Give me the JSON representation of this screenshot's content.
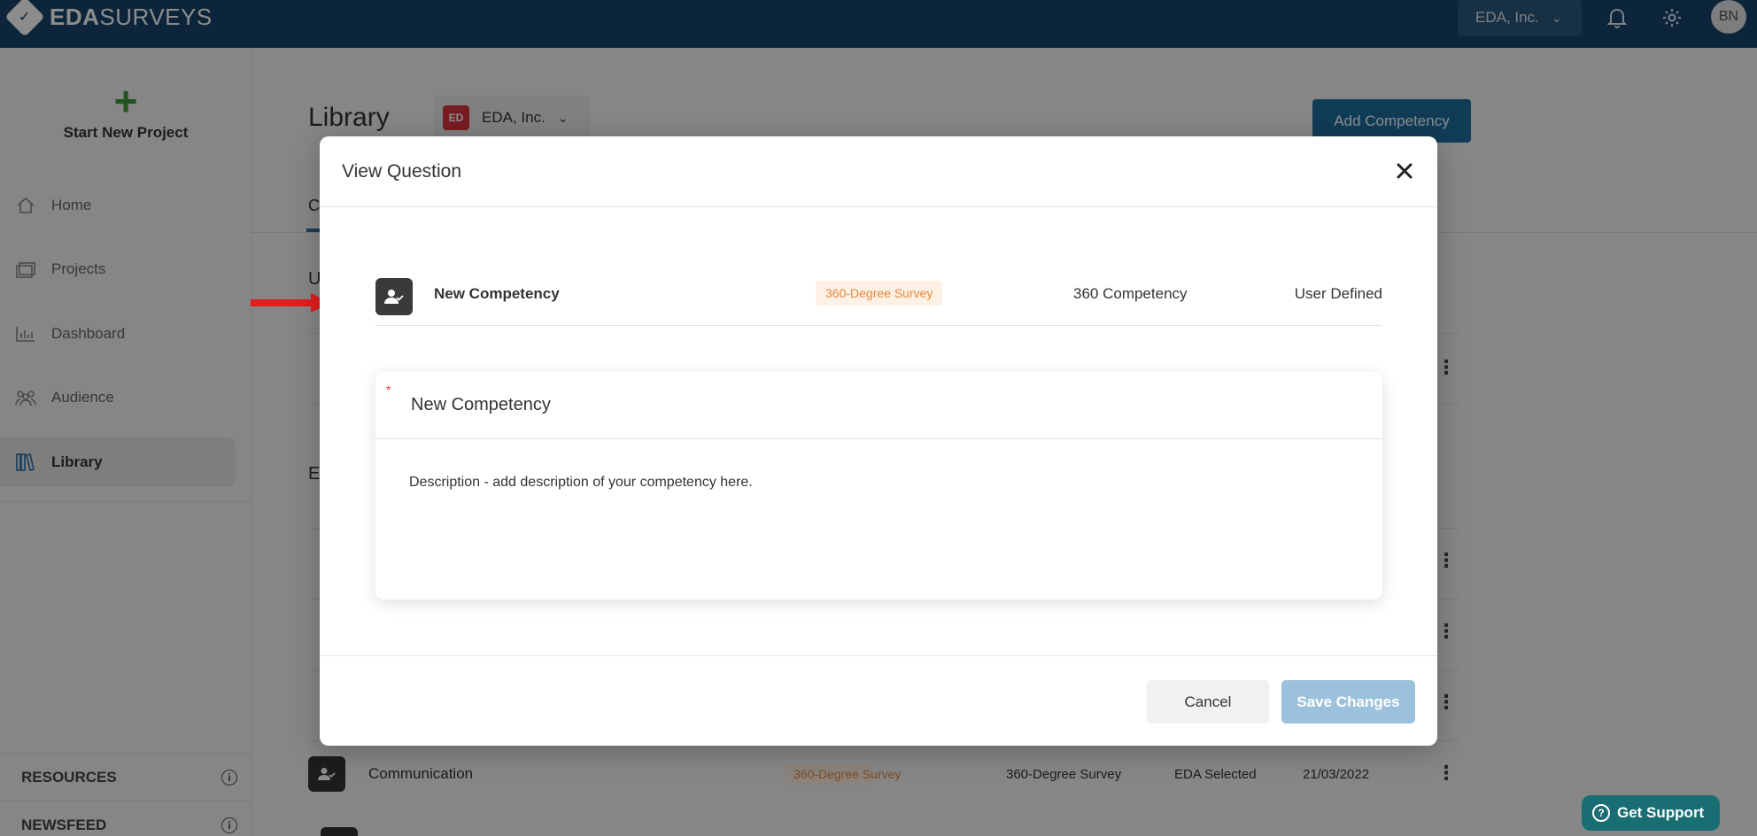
{
  "topbar": {
    "logo_bold": "EDA",
    "logo_light": "SURVEYS",
    "org_label": "EDA, Inc.",
    "avatar_initials": "BN"
  },
  "sidebar": {
    "new_project_label": "Start New Project",
    "items": [
      {
        "label": "Home",
        "icon": "home-icon"
      },
      {
        "label": "Projects",
        "icon": "folders-icon"
      },
      {
        "label": "Dashboard",
        "icon": "bar-chart-icon"
      },
      {
        "label": "Audience",
        "icon": "users-icon"
      },
      {
        "label": "Library",
        "icon": "books-icon",
        "active": true
      }
    ],
    "resources_label": "RESOURCES",
    "newsfeed_label": "NEWSFEED"
  },
  "page": {
    "title": "Library",
    "org_chip_code": "ED",
    "org_chip_label": "EDA, Inc.",
    "add_competency_label": "Add Competency",
    "tab_stub": "C",
    "section_stub_1": "U",
    "section_stub_2": "E",
    "background_row": {
      "name": "Communication",
      "badge": "360-Degree Survey",
      "type": "360-Degree Survey",
      "source": "EDA Selected",
      "date": "21/03/2022"
    }
  },
  "modal": {
    "title": "View Question",
    "question": {
      "name": "New Competency",
      "badge": "360-Degree Survey",
      "type": "360 Competency",
      "source": "User Defined"
    },
    "card": {
      "required_marker": "*",
      "title": "New Competency",
      "description": "Description - add description of your competency here."
    },
    "cancel_label": "Cancel",
    "save_label": "Save Changes"
  },
  "support": {
    "label": "Get Support"
  },
  "colors": {
    "topbar": "#17446a",
    "accent_blue": "#1f6e9e",
    "badge_orange": "#e7883e",
    "badge_bg": "#fdf1e6",
    "save_disabled": "#9cc1dc",
    "support_teal": "#186e72",
    "arrow_red": "#e11d1d",
    "plus_green": "#3c9a37"
  }
}
